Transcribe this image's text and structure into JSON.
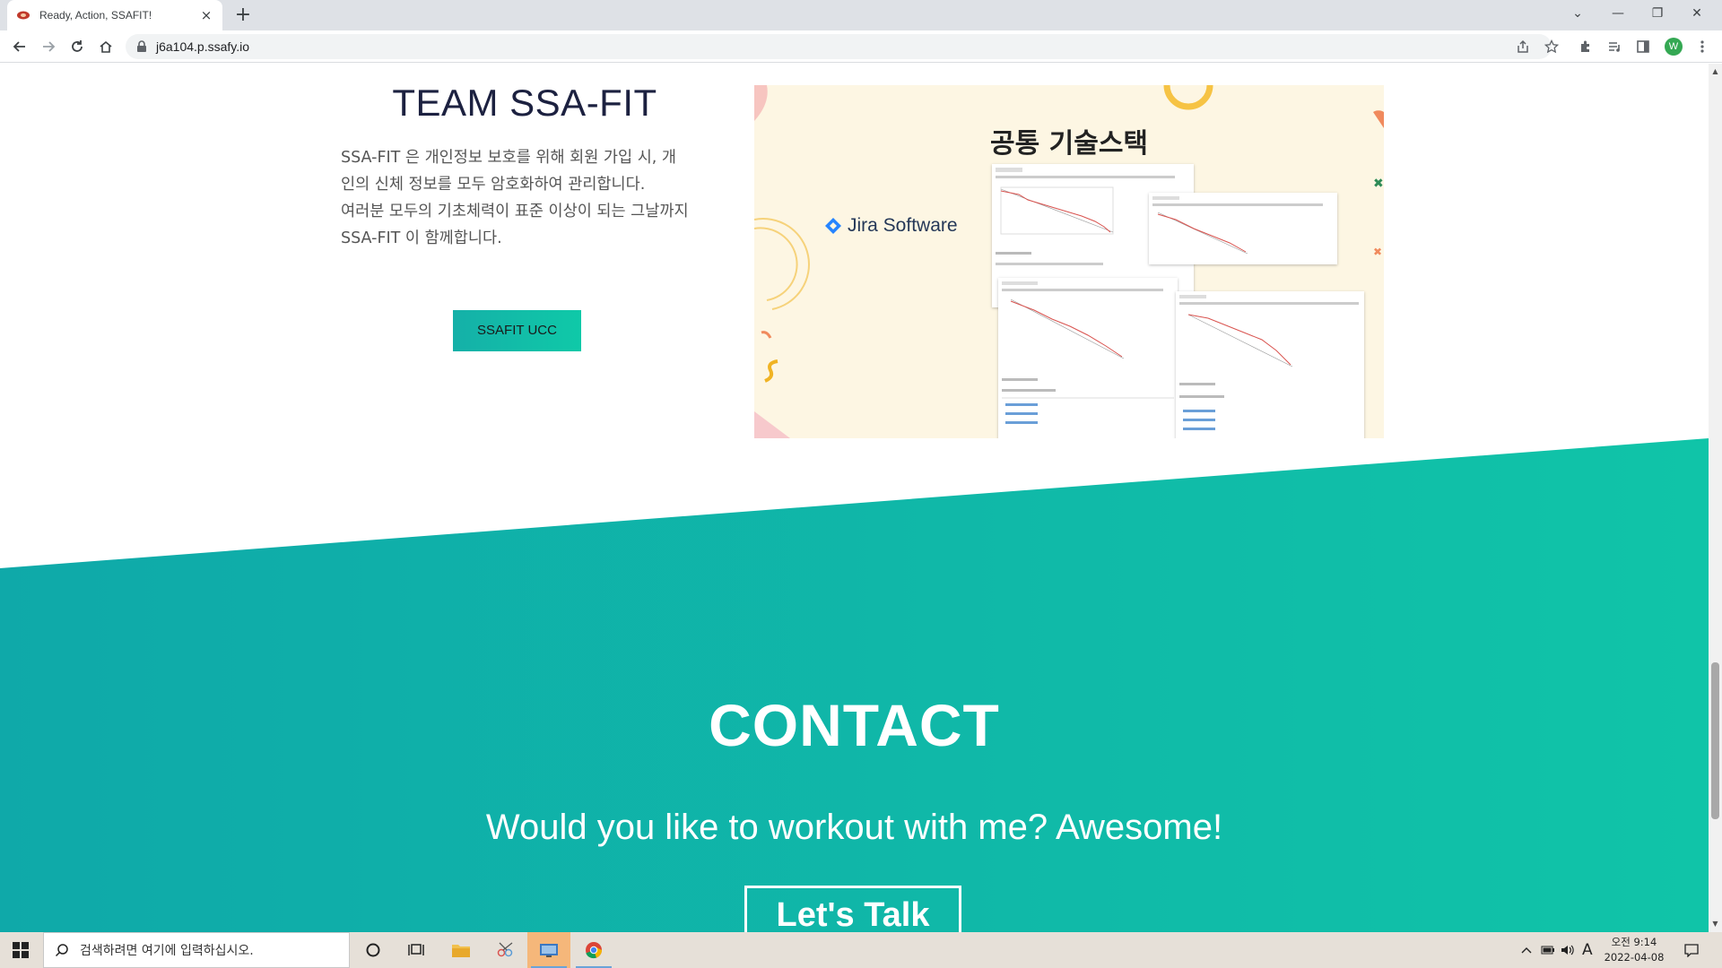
{
  "browser": {
    "tab_title": "Ready, Action, SSAFIT!",
    "tab_close": "×",
    "new_tab": "+",
    "url": "j6a104.p.ssafy.io",
    "profile_initial": "W",
    "window_controls": [
      "⌄",
      "—",
      "❐",
      "✕"
    ]
  },
  "about": {
    "title": "TEAM SSA-FIT",
    "paragraph_1": "SSA-FIT 은 개인정보 보호를 위해 회원 가입 시, 개인의 신체 정보를 모두 암호화하여 관리합니다.",
    "paragraph_2": "여러분 모두의 기초체력이 표준 이상이 되는 그날까지 SSA-FIT 이 함께합니다.",
    "button_label": "SSAFIT UCC"
  },
  "stack_image": {
    "title": "공통 기술스택",
    "jira_label": "Jira Software"
  },
  "contact": {
    "title": "CONTACT",
    "subtitle": "Would you like to workout with me? Awesome!",
    "button_label": "Let's Talk",
    "colors": {
      "gradient_start": "#0fa9a9",
      "gradient_end": "#10c4a8"
    }
  },
  "taskbar": {
    "search_placeholder": "검색하려면 여기에 입력하십시오.",
    "ime_indicator": "A",
    "time": "오전 9:14",
    "date": "2022-04-08"
  }
}
